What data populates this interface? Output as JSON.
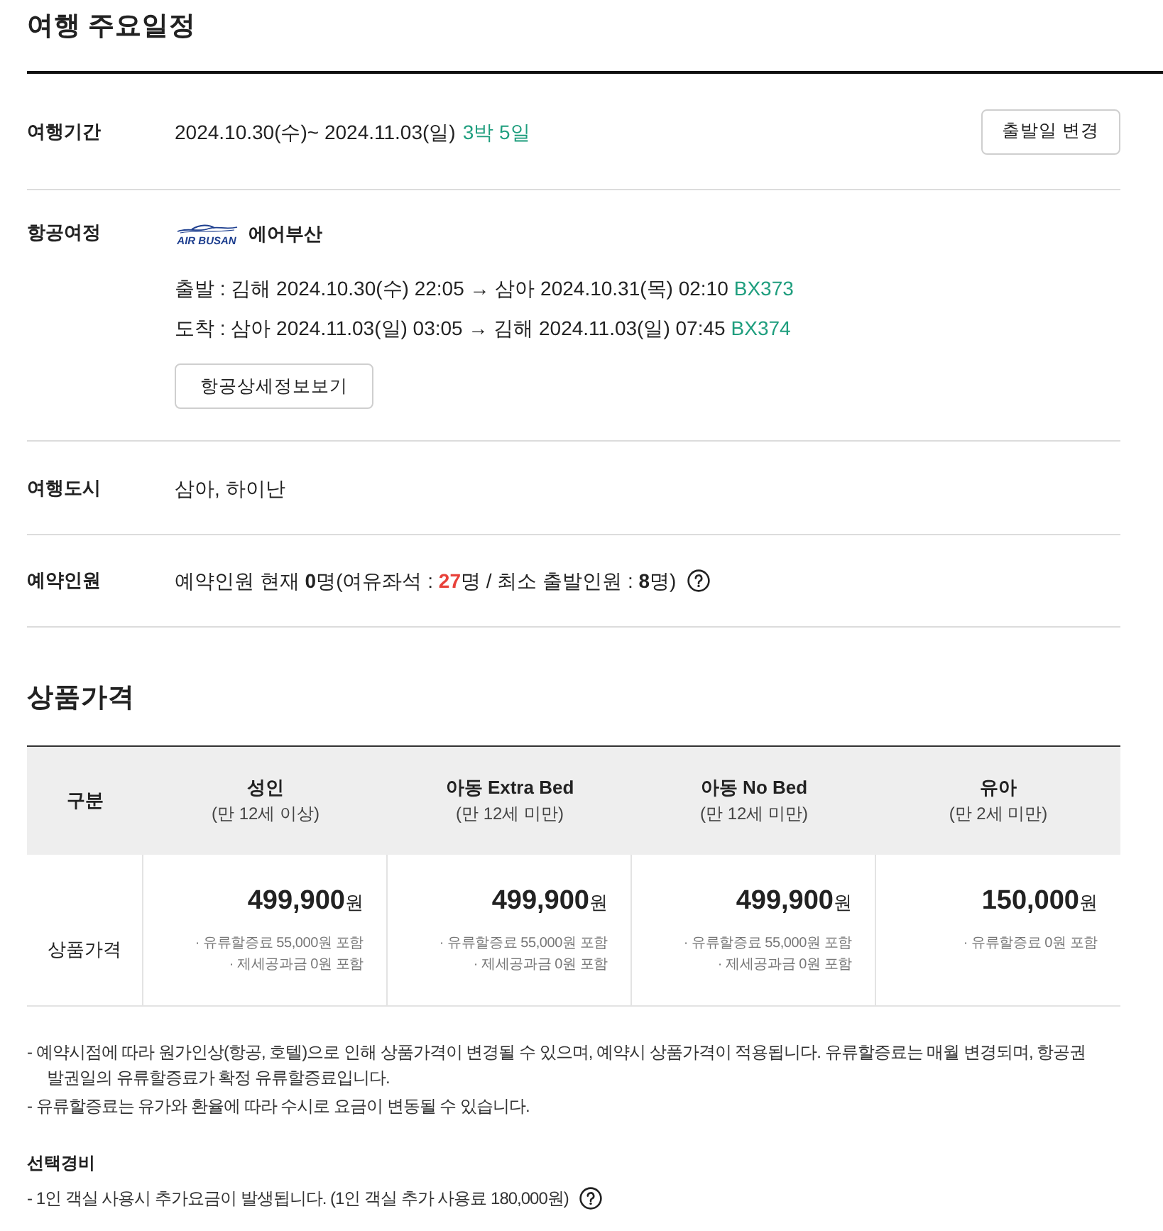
{
  "schedule": {
    "title": "여행 주요일정",
    "rows": [
      {
        "kind": "period",
        "label": "여행기간",
        "dates": "2024.10.30(수)~ 2024.11.03(일)",
        "duration": "3박 5일",
        "button": "출발일 변경"
      },
      {
        "kind": "flight",
        "label": "항공여정",
        "airline": {
          "logo_text": "AIR BUSAN",
          "name": "에어부산"
        },
        "legs": [
          {
            "route": "출발 : 김해 2024.10.30(수) 22:05 → 삼아 2024.10.31(목) 02:10",
            "flight_no": "BX373"
          },
          {
            "route": "도착 : 삼아 2024.11.03(일) 03:05 → 김해 2024.11.03(일) 07:45",
            "flight_no": "BX374"
          }
        ],
        "button": "항공상세정보보기"
      },
      {
        "kind": "text",
        "label": "여행도시",
        "value": "삼아, 하이난"
      },
      {
        "kind": "seats",
        "label": "예약인원",
        "segments": [
          {
            "text": "예약인원 현재 ",
            "kind": "plain"
          },
          {
            "text": "0",
            "kind": "bold"
          },
          {
            "text": "명(여유좌석 : ",
            "kind": "plain"
          },
          {
            "text": "27",
            "kind": "highlight"
          },
          {
            "text": "명 / 최소 출발인원 : ",
            "kind": "plain"
          },
          {
            "text": "8",
            "kind": "bold"
          },
          {
            "text": "명)",
            "kind": "plain"
          }
        ],
        "help": true
      }
    ]
  },
  "pricing": {
    "title": "상품가격",
    "columns": [
      {
        "name": "구분"
      },
      {
        "name": "성인",
        "note": "(만 12세 이상)"
      },
      {
        "name": "아동 Extra Bed",
        "note": "(만 12세 미만)"
      },
      {
        "name": "아동 No Bed",
        "note": "(만 12세 미만)"
      },
      {
        "name": "유아",
        "note": "(만 2세 미만)"
      }
    ],
    "row": {
      "label": "상품가격",
      "cells": [
        {
          "amount": "499,900",
          "unit": "원",
          "details": [
            "· 유류할증료 55,000원 포함",
            "· 제세공과금 0원 포함"
          ]
        },
        {
          "amount": "499,900",
          "unit": "원",
          "details": [
            "· 유류할증료 55,000원 포함",
            "· 제세공과금 0원 포함"
          ]
        },
        {
          "amount": "499,900",
          "unit": "원",
          "details": [
            "· 유류할증료 55,000원 포함",
            "· 제세공과금 0원 포함"
          ]
        },
        {
          "amount": "150,000",
          "unit": "원",
          "details": [
            "· 유류할증료 0원 포함"
          ]
        }
      ]
    },
    "notes": [
      "- 예약시점에 따라 원가인상(항공, 호텔)으로 인해 상품가격이 변경될 수 있으며, 예약시 상품가격이 적용됩니다. 유류할증료는 매월 변경되며, 항공권 발권일의 유류할증료가 확정 유류할증료입니다.",
      "- 유류할증료는 유가와 환율에 따라 수시로 요금이 변동될 수 있습니다."
    ]
  },
  "extras": {
    "title": "선택경비",
    "items": [
      {
        "text": "- 1인 객실 사용시 추가요금이 발생됩니다. (1인 객실 추가 사용료 180,000원)",
        "help": true
      }
    ]
  }
}
